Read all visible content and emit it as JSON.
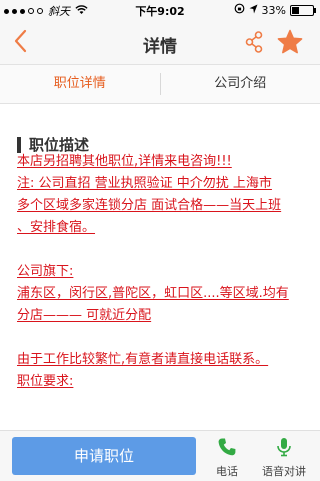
{
  "status_bar": {
    "carrier": "斜天",
    "time": "下午9:02",
    "battery_percent": "33%",
    "battery_level": 0.33
  },
  "nav": {
    "back_icon": "chevron-left-icon",
    "title": "详情",
    "share_icon": "share-icon",
    "favorite_icon": "star-icon",
    "accent_color": "#ef7c46"
  },
  "tabs": [
    {
      "label": "职位详情",
      "active": true
    },
    {
      "label": "公司介绍",
      "active": false
    }
  ],
  "section": {
    "title": "职位描述"
  },
  "description_lines": [
    "本店另招聘其他职位,详情来电咨询!!!",
    "注:  公司直招 营业执照验证 中介勿扰 上海市",
    "多个区域多家连锁分店 面试合格——当天上班",
    "、安排食宿。",
    "",
    "公司旗下:",
    "浦东区，闵行区,普陀区，虹口区....等区域.均有",
    "分店——— 可就近分配",
    "",
    "由于工作比较繁忙,有意者请直接电话联系。",
    "职位要求:"
  ],
  "bottom_bar": {
    "apply_label": "申请职位",
    "phone_label": "电话",
    "voice_label": "语音对讲",
    "phone_icon": "phone-icon",
    "voice_icon": "microphone-icon",
    "icon_color": "#33aa44",
    "apply_color": "#5d9be6"
  }
}
